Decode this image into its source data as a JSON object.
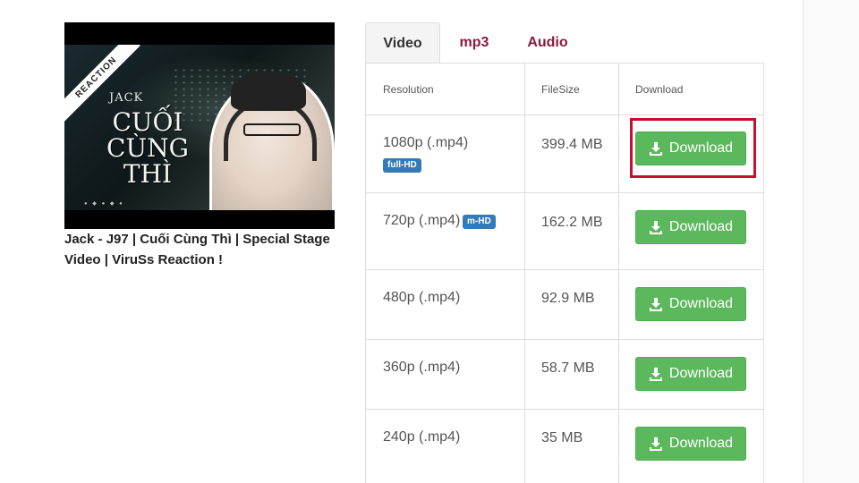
{
  "video": {
    "title": "Jack - J97 | Cuối Cùng Thì | Special Stage Video | ViruSs Reaction !",
    "thumbnail": {
      "ribbon": "REACTION",
      "brand": "JACK",
      "song_title": "CUỐI CÙNG THÌ"
    }
  },
  "tabs": [
    {
      "label": "Video",
      "active": true
    },
    {
      "label": "mp3",
      "active": false
    },
    {
      "label": "Audio",
      "active": false
    }
  ],
  "table": {
    "headers": {
      "resolution": "Resolution",
      "filesize": "FileSize",
      "download": "Download"
    },
    "rows": [
      {
        "resolution": "1080p (.mp4)",
        "badge": "full-HD",
        "size": "399.4 MB",
        "button": "Download"
      },
      {
        "resolution": "720p (.mp4)",
        "badge": "m-HD",
        "size": "162.2 MB",
        "button": "Download"
      },
      {
        "resolution": "480p (.mp4)",
        "badge": "",
        "size": "92.9 MB",
        "button": "Download"
      },
      {
        "resolution": "360p (.mp4)",
        "badge": "",
        "size": "58.7 MB",
        "button": "Download"
      },
      {
        "resolution": "240p (.mp4)",
        "badge": "",
        "size": "35 MB",
        "button": "Download"
      }
    ]
  },
  "colors": {
    "button_green": "#5cb85c",
    "badge_blue": "#337ab7",
    "tab_inactive": "#8b1a3a",
    "highlight_red": "#c8102e"
  },
  "icons": {
    "download": "download-icon"
  }
}
